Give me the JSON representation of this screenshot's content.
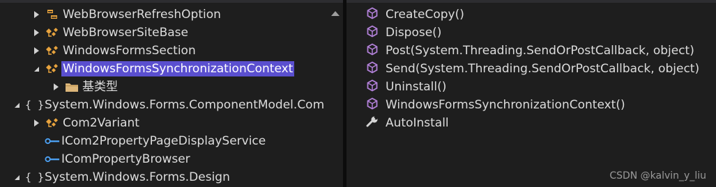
{
  "tree": {
    "items": [
      {
        "label": "WebBrowserRefreshOption",
        "icon": "enum-icon"
      },
      {
        "label": "WebBrowserSiteBase",
        "icon": "class-icon"
      },
      {
        "label": "WindowsFormsSection",
        "icon": "class-icon"
      },
      {
        "label": "WindowsFormsSynchronizationContext",
        "icon": "class-icon",
        "selected": true
      },
      {
        "label": "基类型",
        "icon": "folder-icon"
      },
      {
        "label": "System.Windows.Forms.ComponentModel.Com",
        "icon": "namespace-icon"
      },
      {
        "label": "Com2Variant",
        "icon": "class-icon"
      },
      {
        "label": "ICom2PropertyPageDisplayService",
        "icon": "interface-icon"
      },
      {
        "label": "IComPropertyBrowser",
        "icon": "interface-icon"
      },
      {
        "label": "System.Windows.Forms.Design",
        "icon": "namespace-icon"
      }
    ]
  },
  "members": {
    "items": [
      {
        "label": "CreateCopy()",
        "icon": "method-icon"
      },
      {
        "label": "Dispose()",
        "icon": "method-icon"
      },
      {
        "label": "Post(System.Threading.SendOrPostCallback, object)",
        "icon": "method-icon"
      },
      {
        "label": "Send(System.Threading.SendOrPostCallback, object)",
        "icon": "method-icon"
      },
      {
        "label": "Uninstall()",
        "icon": "method-icon"
      },
      {
        "label": "WindowsFormsSynchronizationContext()",
        "icon": "method-icon"
      },
      {
        "label": "AutoInstall",
        "icon": "wrench-icon"
      }
    ]
  },
  "namespace_glyph": "{ }",
  "watermark": "CSDN @kalvin_y_liu",
  "colors": {
    "background": "#1e1e1e",
    "selection": "#5a4fcf",
    "class_icon": "#e8a33d",
    "method_icon": "#b180d7",
    "interface_icon": "#4da3f7"
  }
}
